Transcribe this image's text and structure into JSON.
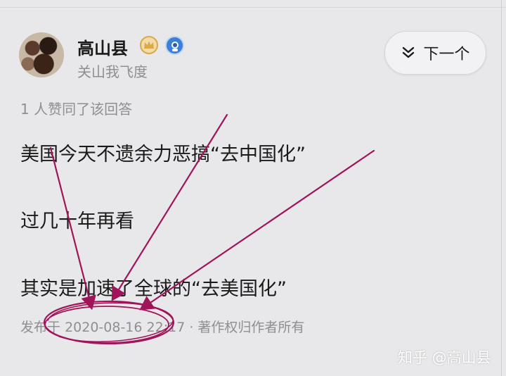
{
  "author": {
    "name": "高山县",
    "bio": "关山我飞度"
  },
  "next_button": {
    "label": "下一个"
  },
  "votes_text": "1 人赞同了该回答",
  "content": {
    "paragraphs": [
      "美国今天不遗余力恶搞“去中国化”",
      "过几十年再看",
      "其实是加速了全球的“去美国化”"
    ]
  },
  "meta": {
    "prefix": "发布于",
    "datetime": "2020-08-16 22:17",
    "separator": "·",
    "copyright": "著作权归作者所有"
  },
  "watermark": "知乎 @高山县",
  "colors": {
    "annotation": "#a0145a",
    "secondary_text": "#8e8e93",
    "badge_gold": "#d9a94a",
    "badge_blue": "#3b7fd8"
  }
}
